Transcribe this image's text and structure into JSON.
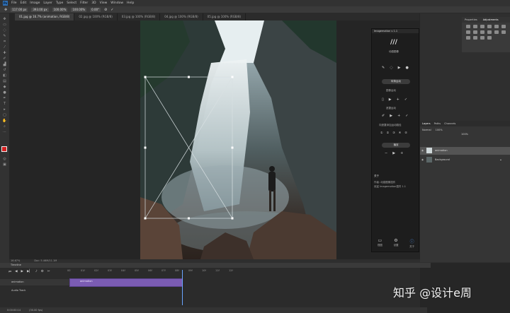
{
  "menu": {
    "app_logo": "Ps",
    "items": [
      "File",
      "Edit",
      "Image",
      "Layer",
      "Type",
      "Select",
      "Filter",
      "3D",
      "View",
      "Window",
      "Help"
    ]
  },
  "options": {
    "x_value": "117.00 px",
    "y_value": "393.00 px",
    "w_value": "100.00%",
    "h_value": "100.00%",
    "angle": "0.00°"
  },
  "doc_tabs": [
    {
      "label": "01.jpg @ 16.7% (animation, RGB/8)",
      "active": true
    },
    {
      "label": "02.jpg @ 100% (RGB/8)",
      "active": false
    },
    {
      "label": "03.jpg @ 100% (RGB/8)",
      "active": false
    },
    {
      "label": "04.jpg @ 100% (RGB/8)",
      "active": false
    },
    {
      "label": "05.jpg @ 100% (RGB/8)",
      "active": false
    }
  ],
  "status": {
    "zoom": "16.67%",
    "doc": "Doc: 5.46M/11.1M"
  },
  "plugin": {
    "title": "Imagemotion v 1.1",
    "logo": "///",
    "name": "动感图像",
    "section1": "转换运动",
    "label1": "图像运动",
    "label2": "遮罩运动",
    "label3": "向遮罩添加运动路径",
    "button2": "播放",
    "about_title": "关于",
    "about_line1": "作者: 动感图像插件",
    "about_line2": "欢迎 Imagemotion插件 1.1",
    "nav": [
      {
        "icon": "monitor-icon",
        "label": "视图"
      },
      {
        "icon": "gear-icon",
        "label": "设置"
      },
      {
        "icon": "info-icon",
        "label": "关于"
      }
    ]
  },
  "adjustments": {
    "tabs": [
      "Properties",
      "Adjustments"
    ]
  },
  "layers": {
    "tabs": [
      "Layers",
      "Paths",
      "Channels"
    ],
    "kind": "Normal",
    "opacity": "100%",
    "fill": "100%",
    "items": [
      {
        "name": "animation",
        "selected": true
      },
      {
        "name": "Background",
        "selected": false
      }
    ]
  },
  "timeline": {
    "title": "Timeline",
    "ruler": [
      "00",
      "01f",
      "02f",
      "03f",
      "04f",
      "05f",
      "06f",
      "07f",
      "08f",
      "09f",
      "10f",
      "11f",
      "12f"
    ],
    "track1": "animation",
    "track2": "Audio Track",
    "clip": "animation",
    "time": "0:00:00:14",
    "fps": "(30.00 fps)"
  },
  "watermark": "知乎 @设计e周",
  "colors": {
    "accent": "#7b5cb3",
    "playhead": "#6aa5ff",
    "foreground": "#d42020",
    "background": "#ffffff"
  }
}
